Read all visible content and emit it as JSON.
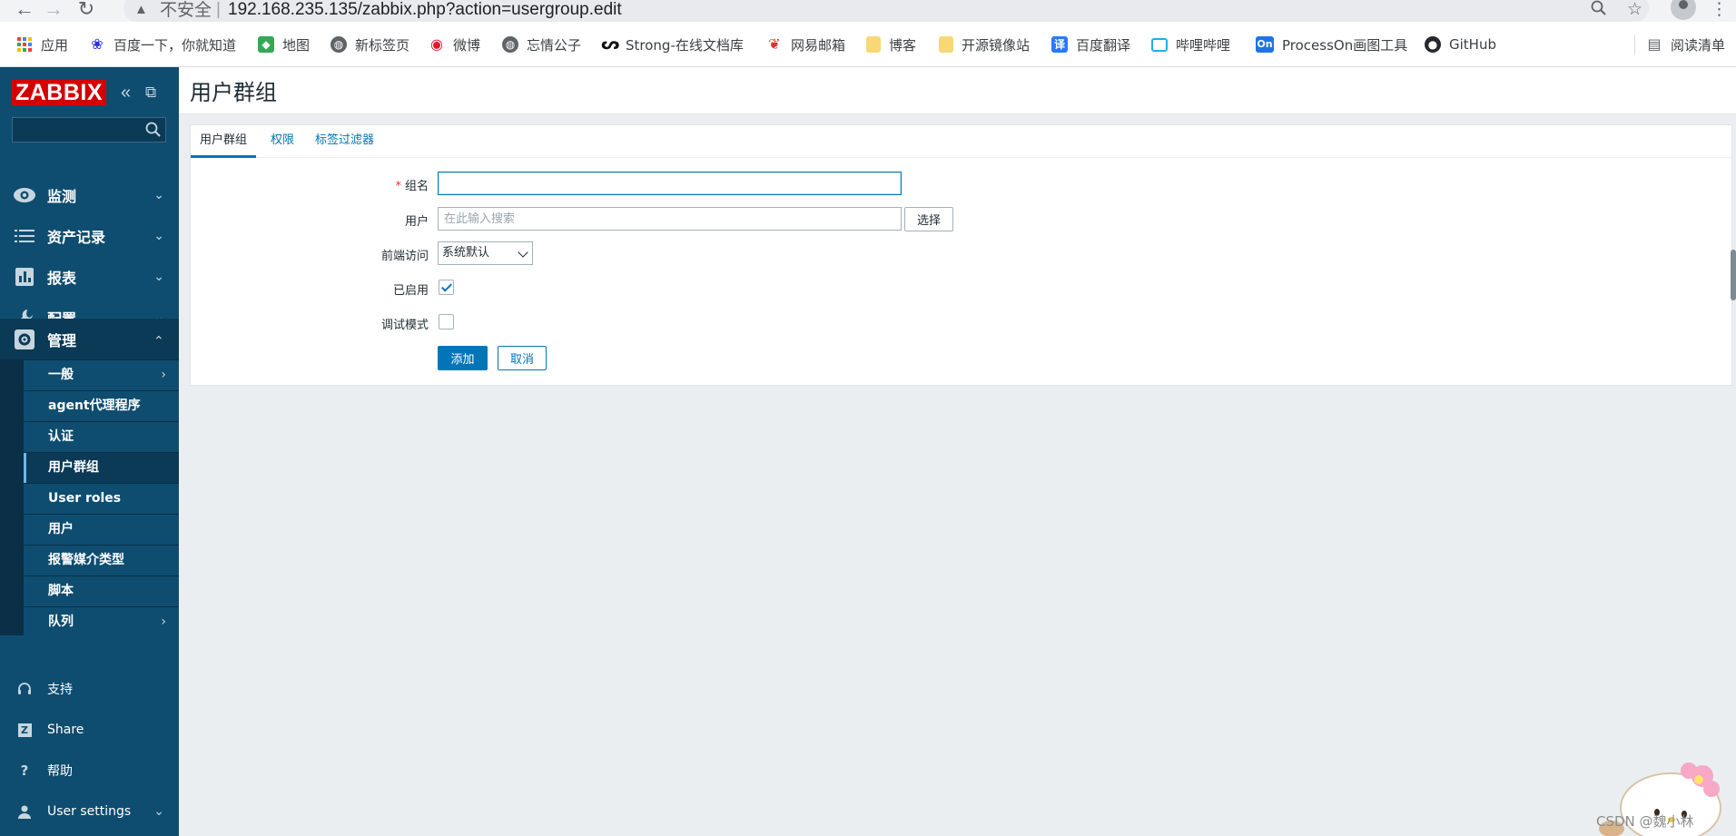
{
  "browser": {
    "insecure_label": "不安全",
    "url": "192.168.235.135/zabbix.php?action=usergroup.edit",
    "bookmarks": [
      {
        "label": "应用",
        "icon": "apps-grid-icon"
      },
      {
        "label": "百度一下，你就知道",
        "icon": "baidu-paw-icon"
      },
      {
        "label": "地图",
        "icon": "maps-icon"
      },
      {
        "label": "新标签页",
        "icon": "globe-icon"
      },
      {
        "label": "微博",
        "icon": "weibo-icon"
      },
      {
        "label": "忘情公子",
        "icon": "globe-icon"
      },
      {
        "label": "Strong-在线文档库",
        "icon": "strong-logo-icon"
      },
      {
        "label": "网易邮箱",
        "icon": "netease-mail-icon"
      },
      {
        "label": "博客",
        "icon": "folder-icon"
      },
      {
        "label": "开源镜像站",
        "icon": "folder-icon"
      },
      {
        "label": "百度翻译",
        "icon": "baidu-translate-icon"
      },
      {
        "label": "哔哩哔哩",
        "icon": "bilibili-icon"
      },
      {
        "label": "ProcessOn画图工具",
        "icon": "processon-icon"
      },
      {
        "label": "GitHub",
        "icon": "github-icon"
      }
    ],
    "reading_list": "阅读清单"
  },
  "sidebar": {
    "logo": "ZABBIX",
    "search_placeholder": "",
    "menu": [
      {
        "label": "监测",
        "icon": "eye-icon"
      },
      {
        "label": "资产记录",
        "icon": "list-icon"
      },
      {
        "label": "报表",
        "icon": "bar-chart-icon"
      },
      {
        "label": "配置",
        "icon": "wrench-icon"
      },
      {
        "label": "管理",
        "icon": "gear-icon"
      }
    ],
    "admin_submenu": [
      {
        "label": "一般"
      },
      {
        "label": "agent代理程序"
      },
      {
        "label": "认证"
      },
      {
        "label": "用户群组"
      },
      {
        "label": "User roles"
      },
      {
        "label": "用户"
      },
      {
        "label": "报警媒介类型"
      },
      {
        "label": "脚本"
      },
      {
        "label": "队列"
      }
    ],
    "footer": [
      {
        "label": "支持",
        "icon": "headset-icon"
      },
      {
        "label": "Share",
        "icon": "zabbix-share-icon"
      },
      {
        "label": "帮助",
        "icon": "question-icon"
      },
      {
        "label": "User settings",
        "icon": "user-icon"
      }
    ]
  },
  "page": {
    "title": "用户群组",
    "tabs": [
      "用户群组",
      "权限",
      "标签过滤器"
    ],
    "form": {
      "group_name_label": "组名",
      "group_name_value": "",
      "users_label": "用户",
      "users_placeholder": "在此输入搜索",
      "select_button": "选择",
      "frontend_access_label": "前端访问",
      "frontend_access_value": "系统默认",
      "enabled_label": "已启用",
      "enabled": true,
      "debug_label": "调试模式",
      "debug": false,
      "add_button": "添加",
      "cancel_button": "取消"
    }
  },
  "watermark": "CSDN @魏小林"
}
